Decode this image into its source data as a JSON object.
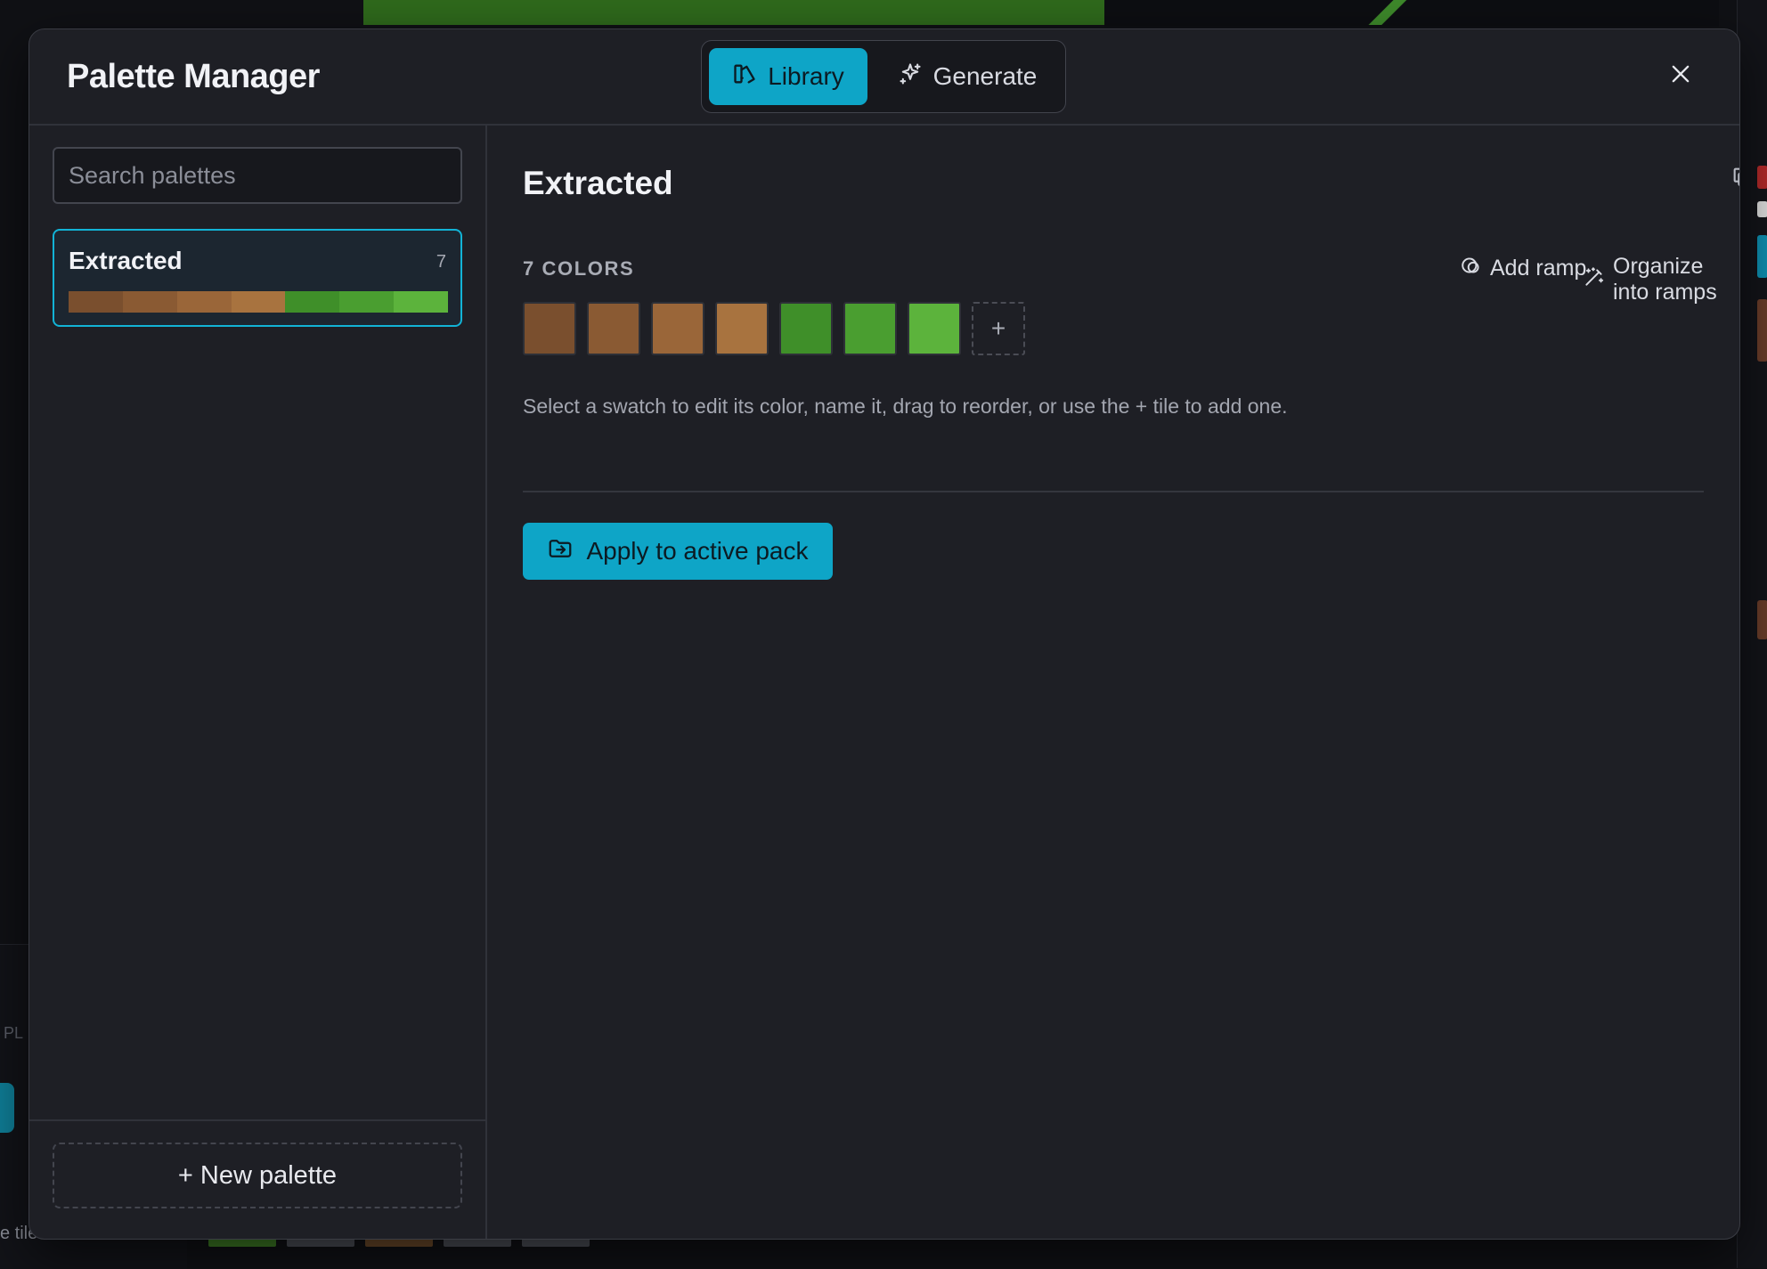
{
  "modal": {
    "title": "Palette Manager",
    "tabs": [
      {
        "label": "Library",
        "icon": "library-icon",
        "active": true
      },
      {
        "label": "Generate",
        "icon": "sparkles-icon",
        "active": false
      }
    ],
    "close_icon": "close-icon"
  },
  "sidebar": {
    "search_placeholder": "Search palettes",
    "palettes": [
      {
        "name": "Extracted",
        "count": "7",
        "selected": true,
        "colors": [
          "#7a4f2e",
          "#8a5a33",
          "#9a6639",
          "#a8733f",
          "#3f8f29",
          "#4a9e30",
          "#5cb33c"
        ]
      }
    ],
    "new_palette_label": "+ New palette"
  },
  "main": {
    "palette_name": "Extracted",
    "colors_label": "7 COLORS",
    "add_ramp_label": "Add ramp",
    "organize_label": "Organize into ramps",
    "swatches": [
      "#7a4f2e",
      "#8a5a33",
      "#9a6639",
      "#a8733f",
      "#3f8f29",
      "#4a9e30",
      "#5cb33c"
    ],
    "add_tile_label": "+",
    "hint": "Select a swatch to edit its color, name it, drag to reorder, or use the + tile to add one.",
    "apply_label": "Apply to active pack"
  },
  "background": {
    "left_panel_text": "PL",
    "left_tiles_text": "e tiles"
  },
  "colors": {
    "accent": "#0ea5c7",
    "modal_bg": "#1e1f25",
    "border": "#30323a"
  }
}
